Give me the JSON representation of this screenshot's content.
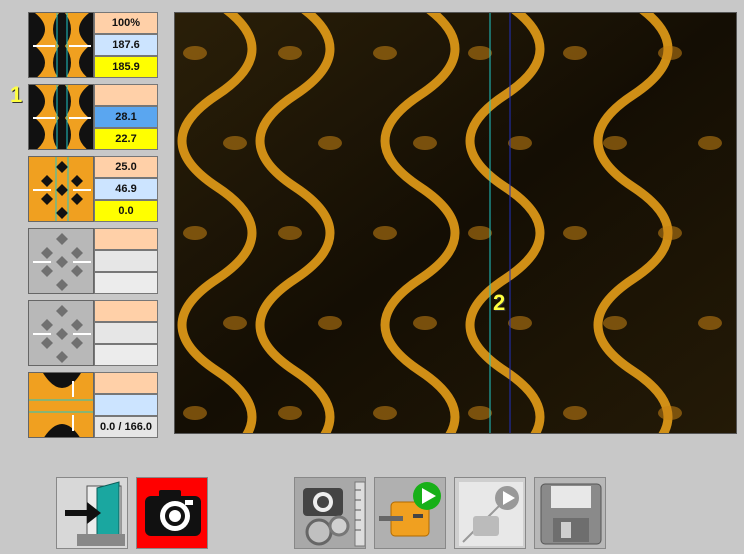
{
  "panels": [
    {
      "id": "wave-width",
      "values": [
        "100%",
        "187.6",
        "185.9"
      ],
      "colors": [
        "v-peach",
        "v-blue",
        "v-yellow"
      ],
      "thumb_bg": "#f0a020"
    },
    {
      "id": "wave-gap",
      "values": [
        "",
        "28.1",
        "22.7"
      ],
      "colors": [
        "v-peach",
        "v-selblue",
        "v-yellow"
      ],
      "thumb_bg": "#f0a020"
    },
    {
      "id": "diamond-spacing",
      "values": [
        "25.0",
        "46.9",
        "0.0"
      ],
      "colors": [
        "v-peach",
        "v-blue",
        "v-yellow"
      ],
      "thumb_bg": "#f0a020"
    },
    {
      "id": "diamond-disabled-1",
      "values": [
        "",
        "",
        ""
      ],
      "colors": [
        "v-peach",
        "v-gray",
        "v-lgray"
      ],
      "thumb_bg": "#b8b8b8"
    },
    {
      "id": "diamond-disabled-2",
      "values": [
        "",
        "",
        ""
      ],
      "colors": [
        "v-peach",
        "v-gray",
        "v-lgray"
      ],
      "thumb_bg": "#b8b8b8"
    },
    {
      "id": "thickness",
      "values": [
        "",
        "",
        "0.0 / 166.0"
      ],
      "colors": [
        "v-peach",
        "v-blue",
        "v-gray"
      ],
      "thumb_bg": "#f0a020"
    }
  ],
  "markers": {
    "panel_marker": "1",
    "line_marker": "2"
  },
  "toolbar": [
    {
      "name": "exit-button",
      "icon": "door-exit-icon"
    },
    {
      "name": "capture-button",
      "icon": "camera-icon"
    },
    {
      "name": "camera-settings-button",
      "icon": "camera-gears-icon"
    },
    {
      "name": "run-measurement-button",
      "icon": "play-cylinder-icon"
    },
    {
      "name": "playback-chart-button",
      "icon": "chart-play-icon"
    },
    {
      "name": "save-button",
      "icon": "floppy-disk-icon"
    }
  ],
  "colors": {
    "accent": "#f0a020",
    "capture_bg": "#ff0000",
    "guide_cyan": "#20c8c8",
    "guide_blue": "#2030c0",
    "mesh": "#e09a18"
  }
}
